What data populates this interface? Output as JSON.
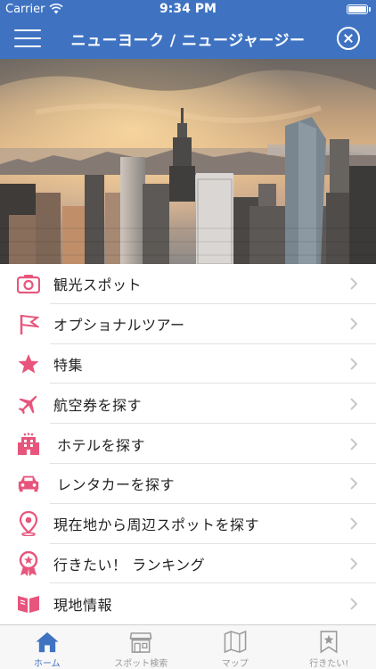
{
  "status_bar": {
    "carrier": "Carrier",
    "time": "9:34 PM",
    "battery_level": 1.0
  },
  "nav": {
    "title": "ニューヨーク / ニュージャージー",
    "menu_icon": "hamburger-menu-icon",
    "close_icon": "close-circle-icon"
  },
  "hero": {
    "description_icon": "city-skyline-photo"
  },
  "menu": {
    "icon_color": "#e8557c",
    "items": [
      {
        "label": "観光スポット",
        "icon": "camera-icon"
      },
      {
        "label": "オプショナルツアー",
        "icon": "flag-icon"
      },
      {
        "label": "特集",
        "icon": "star-icon"
      },
      {
        "label": "航空券を探す",
        "icon": "airplane-icon"
      },
      {
        "label": "ホテルを探す",
        "icon": "hotel-icon"
      },
      {
        "label": "レンタカーを探す",
        "icon": "car-icon"
      },
      {
        "label": "現在地から周辺スポットを探す",
        "icon": "location-pin-icon"
      },
      {
        "label": "行きたい！ ランキング",
        "icon": "ribbon-badge-icon"
      },
      {
        "label": "現地情報",
        "icon": "book-icon"
      }
    ]
  },
  "tab_bar": {
    "active_color": "#3f73c2",
    "inactive_color": "#9a9a9a",
    "tabs": [
      {
        "label": "ホーム",
        "icon": "home-icon",
        "active": true
      },
      {
        "label": "スポット検索",
        "icon": "shop-icon",
        "active": false
      },
      {
        "label": "マップ",
        "icon": "map-icon",
        "active": false
      },
      {
        "label": "行きたい!",
        "icon": "bookmark-star-icon",
        "active": false
      }
    ]
  }
}
